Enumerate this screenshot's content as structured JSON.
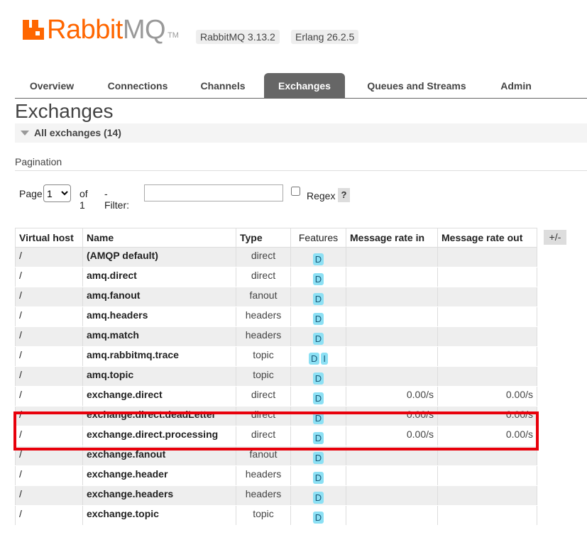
{
  "header": {
    "logo_word_1": "Rabbit",
    "logo_word_2": "MQ",
    "logo_tm": "TM",
    "rabbitmq_version": "RabbitMQ 3.13.2",
    "erlang_version": "Erlang 26.2.5"
  },
  "tabs": [
    {
      "label": "Overview"
    },
    {
      "label": "Connections"
    },
    {
      "label": "Channels"
    },
    {
      "label": "Exchanges",
      "active": true
    },
    {
      "label": "Queues and Streams"
    },
    {
      "label": "Admin"
    }
  ],
  "page_title": "Exchanges",
  "section": {
    "label": "All exchanges (14)"
  },
  "pagination": {
    "title": "Pagination",
    "page_label": "Page",
    "page_value": "1",
    "of_label": "of 1",
    "filter_label": "- Filter:",
    "filter_value": "",
    "regex_label": "Regex",
    "help_label": "?"
  },
  "table": {
    "columns": [
      "Virtual host",
      "Name",
      "Type",
      "Features",
      "Message rate in",
      "Message rate out"
    ],
    "toggle_label": "+/-",
    "rows": [
      {
        "vhost": "/",
        "name": "(AMQP default)",
        "type": "direct",
        "features": [
          "D"
        ],
        "rate_in": "",
        "rate_out": ""
      },
      {
        "vhost": "/",
        "name": "amq.direct",
        "type": "direct",
        "features": [
          "D"
        ],
        "rate_in": "",
        "rate_out": ""
      },
      {
        "vhost": "/",
        "name": "amq.fanout",
        "type": "fanout",
        "features": [
          "D"
        ],
        "rate_in": "",
        "rate_out": ""
      },
      {
        "vhost": "/",
        "name": "amq.headers",
        "type": "headers",
        "features": [
          "D"
        ],
        "rate_in": "",
        "rate_out": ""
      },
      {
        "vhost": "/",
        "name": "amq.match",
        "type": "headers",
        "features": [
          "D"
        ],
        "rate_in": "",
        "rate_out": ""
      },
      {
        "vhost": "/",
        "name": "amq.rabbitmq.trace",
        "type": "topic",
        "features": [
          "D",
          "I"
        ],
        "rate_in": "",
        "rate_out": ""
      },
      {
        "vhost": "/",
        "name": "amq.topic",
        "type": "topic",
        "features": [
          "D"
        ],
        "rate_in": "",
        "rate_out": ""
      },
      {
        "vhost": "/",
        "name": "exchange.direct",
        "type": "direct",
        "features": [
          "D"
        ],
        "rate_in": "0.00/s",
        "rate_out": "0.00/s"
      },
      {
        "vhost": "/",
        "name": "exchange.direct.deadLetter",
        "type": "direct",
        "features": [
          "D"
        ],
        "rate_in": "0.00/s",
        "rate_out": "0.00/s"
      },
      {
        "vhost": "/",
        "name": "exchange.direct.processing",
        "type": "direct",
        "features": [
          "D"
        ],
        "rate_in": "0.00/s",
        "rate_out": "0.00/s"
      },
      {
        "vhost": "/",
        "name": "exchange.fanout",
        "type": "fanout",
        "features": [
          "D"
        ],
        "rate_in": "",
        "rate_out": ""
      },
      {
        "vhost": "/",
        "name": "exchange.header",
        "type": "headers",
        "features": [
          "D"
        ],
        "rate_in": "",
        "rate_out": ""
      },
      {
        "vhost": "/",
        "name": "exchange.headers",
        "type": "headers",
        "features": [
          "D"
        ],
        "rate_in": "",
        "rate_out": ""
      },
      {
        "vhost": "/",
        "name": "exchange.topic",
        "type": "topic",
        "features": [
          "D"
        ],
        "rate_in": "",
        "rate_out": ""
      }
    ]
  },
  "colors": {
    "brand": "#ff6600",
    "active_tab": "#666666",
    "highlight": "#e8000b",
    "feature_badge": "#8ce0f4"
  }
}
